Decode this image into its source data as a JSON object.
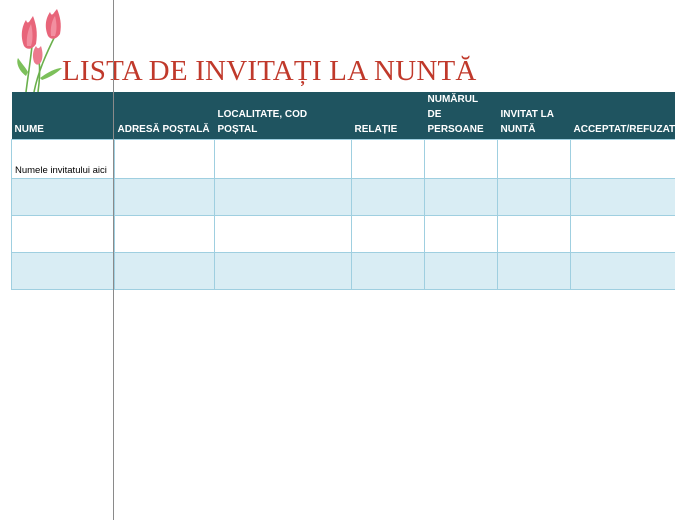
{
  "title": "LISTA DE INVITAȚI LA NUNTĂ",
  "colors": {
    "title": "#c0392b",
    "header_bg": "#1f5460",
    "row_alt": "#d9edf4",
    "row_plain": "#ffffff",
    "grid": "#9fcfe0"
  },
  "decoration": {
    "icon": "tulips-icon"
  },
  "table": {
    "headers": [
      "NUME",
      "ADRESĂ POȘTALĂ",
      "LOCALITATE, COD POȘTAL",
      "RELAȚIE",
      "NUMĂRUL DE PERSOANE",
      "INVITAT LA NUNTĂ",
      "ACCEPTAT/REFUZAT"
    ],
    "rows": [
      [
        "Numele invitatului aici",
        "",
        "",
        "",
        "",
        "",
        ""
      ],
      [
        "",
        "",
        "",
        "",
        "",
        "",
        ""
      ],
      [
        "",
        "",
        "",
        "",
        "",
        "",
        ""
      ],
      [
        "",
        "",
        "",
        "",
        "",
        "",
        ""
      ]
    ]
  }
}
